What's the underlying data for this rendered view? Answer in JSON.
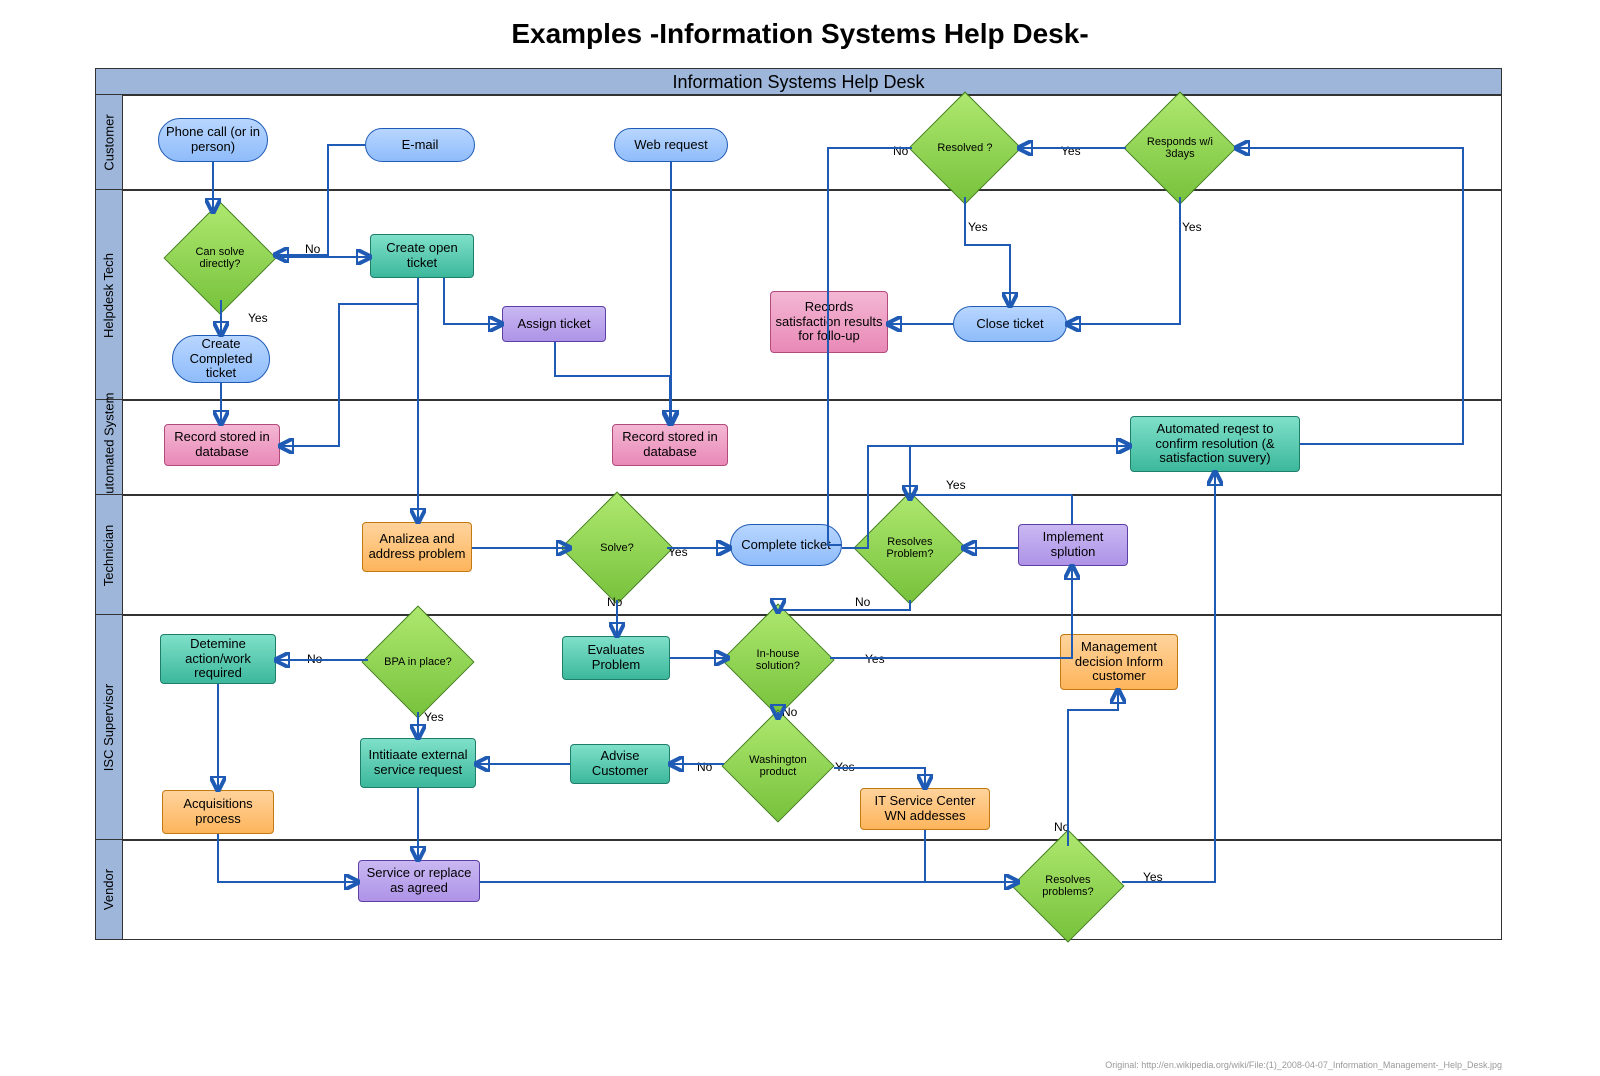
{
  "title": "Examples -Information Systems Help Desk-",
  "pool": "Information Systems Help Desk",
  "lanes": [
    "Customer",
    "Helpdesk Tech",
    "Automated System",
    "Technician",
    "ISC Supervisor",
    "Vendor"
  ],
  "nodes": {
    "phone": "Phone call (or in person)",
    "email": "E-mail",
    "web": "Web request",
    "resolved": "Resolved ?",
    "responds": "Responds w/i 3days",
    "can_solve": "Can solve directly?",
    "create_open": "Create open ticket",
    "assign": "Assign ticket",
    "close": "Close ticket",
    "records_sat": "Records satisfaction results for follo-up",
    "create_completed": "Create Completed ticket",
    "record_db1": "Record stored in database",
    "record_db2": "Record stored in database",
    "auto_req": "Automated reqest to confirm resolution (& satisfaction suvery)",
    "analyze": "Analizea and address problem",
    "solve": "Solve?",
    "complete": "Complete ticket",
    "resolves_prob": "Resolves Problem?",
    "implement": "Implement splution",
    "determine": "Detemine action/work required",
    "bpa": "BPA in place?",
    "evaluates": "Evaluates Problem",
    "inhouse": "In-house solution?",
    "mgmt": "Management decision Inform customer",
    "initiate": "Intitiaate external service request",
    "advise": "Advise Customer",
    "washington": "Washington product",
    "itsc": "IT Service Center WN addesses",
    "acq": "Acquisitions process",
    "service": "Service or replace as agreed",
    "resolves2": "Resolves problems?"
  },
  "labels": {
    "yes": "Yes",
    "no": "No"
  },
  "chart_data": {
    "type": "swimlane_flowchart",
    "pool": "Information Systems Help Desk",
    "lanes": [
      "Customer",
      "Helpdesk Tech",
      "Automated System",
      "Technician",
      "ISC Supervisor",
      "Vendor"
    ],
    "node_types": {
      "terminator": [
        "phone",
        "email",
        "web",
        "create_completed",
        "complete",
        "close"
      ],
      "process": [
        "create_open",
        "assign",
        "records_sat",
        "record_db1",
        "record_db2",
        "auto_req",
        "analyze",
        "implement",
        "determine",
        "evaluates",
        "mgmt",
        "initiate",
        "advise",
        "itsc",
        "acq",
        "service"
      ],
      "decision": [
        "resolved",
        "responds",
        "can_solve",
        "solve",
        "resolves_prob",
        "bpa",
        "inhouse",
        "washington",
        "resolves2"
      ]
    },
    "node_lane": {
      "phone": "Customer",
      "email": "Customer",
      "web": "Customer",
      "resolved": "Customer",
      "responds": "Customer",
      "can_solve": "Helpdesk Tech",
      "create_open": "Helpdesk Tech",
      "assign": "Helpdesk Tech",
      "close": "Helpdesk Tech",
      "records_sat": "Helpdesk Tech",
      "create_completed": "Helpdesk Tech",
      "record_db1": "Automated System",
      "record_db2": "Automated System",
      "auto_req": "Automated System",
      "analyze": "Technician",
      "solve": "Technician",
      "complete": "Technician",
      "resolves_prob": "Technician",
      "implement": "Technician",
      "determine": "ISC Supervisor",
      "bpa": "ISC Supervisor",
      "evaluates": "ISC Supervisor",
      "inhouse": "ISC Supervisor",
      "mgmt": "ISC Supervisor",
      "initiate": "ISC Supervisor",
      "advise": "ISC Supervisor",
      "washington": "ISC Supervisor",
      "itsc": "ISC Supervisor",
      "acq": "ISC Supervisor",
      "service": "Vendor",
      "resolves2": "Vendor"
    },
    "edges": [
      {
        "from": "phone",
        "to": "can_solve"
      },
      {
        "from": "email",
        "to": "can_solve"
      },
      {
        "from": "web",
        "to": "record_db2"
      },
      {
        "from": "can_solve",
        "to": "create_completed",
        "label": "Yes"
      },
      {
        "from": "can_solve",
        "to": "create_open",
        "label": "No"
      },
      {
        "from": "create_completed",
        "to": "record_db1"
      },
      {
        "from": "create_open",
        "to": "record_db1"
      },
      {
        "from": "create_open",
        "to": "assign"
      },
      {
        "from": "create_open",
        "to": "analyze"
      },
      {
        "from": "assign",
        "to": "record_db2"
      },
      {
        "from": "analyze",
        "to": "solve"
      },
      {
        "from": "solve",
        "to": "complete",
        "label": "Yes"
      },
      {
        "from": "solve",
        "to": "evaluates",
        "label": "No"
      },
      {
        "from": "complete",
        "to": "auto_req"
      },
      {
        "from": "evaluates",
        "to": "inhouse"
      },
      {
        "from": "inhouse",
        "to": "implement",
        "label": "Yes"
      },
      {
        "from": "inhouse",
        "to": "washington",
        "label": "No"
      },
      {
        "from": "implement",
        "to": "resolves_prob"
      },
      {
        "from": "resolves_prob",
        "to": "auto_req",
        "label": "Yes"
      },
      {
        "from": "resolves_prob",
        "to": "inhouse",
        "label": "No"
      },
      {
        "from": "washington",
        "to": "itsc",
        "label": "Yes"
      },
      {
        "from": "washington",
        "to": "advise",
        "label": "No"
      },
      {
        "from": "advise",
        "to": "initiate"
      },
      {
        "from": "bpa",
        "to": "initiate",
        "label": "Yes"
      },
      {
        "from": "bpa",
        "to": "determine",
        "label": "No"
      },
      {
        "from": "determine",
        "to": "acq"
      },
      {
        "from": "acq",
        "to": "service"
      },
      {
        "from": "initiate",
        "to": "service"
      },
      {
        "from": "service",
        "to": "resolves2"
      },
      {
        "from": "itsc",
        "to": "resolves2"
      },
      {
        "from": "resolves2",
        "to": "auto_req",
        "label": "Yes"
      },
      {
        "from": "resolves2",
        "to": "mgmt",
        "label": "No"
      },
      {
        "from": "auto_req",
        "to": "responds"
      },
      {
        "from": "responds",
        "to": "resolved",
        "label": "Yes"
      },
      {
        "from": "responds",
        "to": "close",
        "label": "Yes"
      },
      {
        "from": "resolved",
        "to": "close",
        "label": "Yes"
      },
      {
        "from": "resolved",
        "to": "complete",
        "label": "No"
      },
      {
        "from": "close",
        "to": "records_sat"
      }
    ]
  },
  "credit": "Original: http://en.wikipedia.org/wiki/File:(1)_2008-04-07_Information_Management-_Help_Desk.jpg"
}
